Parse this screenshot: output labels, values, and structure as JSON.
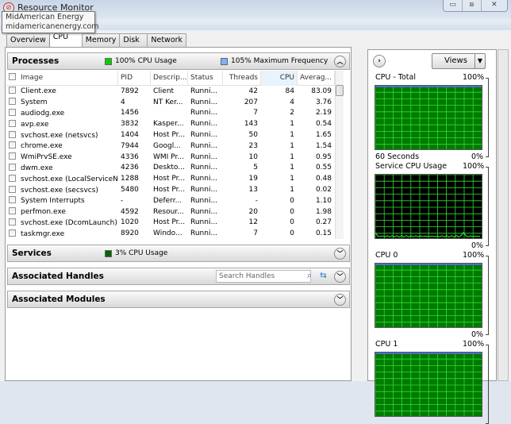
{
  "window": {
    "title": "Resource Monitor",
    "controls": [
      "▭",
      "⧈",
      "✕"
    ]
  },
  "tooltip": {
    "line1": "MidAmerican Energy",
    "line2": "midamericanenergy.com"
  },
  "tabs": [
    "Overview",
    "CPU",
    "Memory",
    "Disk",
    "Network"
  ],
  "active_tab": "CPU",
  "processes": {
    "title": "Processes",
    "cpu_usage": "100% CPU Usage",
    "cpu_usage_color": "#00d000",
    "max_freq": "105% Maximum Frequency",
    "max_freq_color": "#80b0ff",
    "columns": [
      "Image",
      "PID",
      "Descrip...",
      "Status",
      "Threads",
      "CPU",
      "Averag..."
    ],
    "rows": [
      [
        "Client.exe",
        "7892",
        "Client",
        "Runni...",
        "42",
        "84",
        "83.09"
      ],
      [
        "System",
        "4",
        "NT Ker...",
        "Runni...",
        "207",
        "4",
        "3.76"
      ],
      [
        "audiodg.exe",
        "1456",
        "",
        "Runni...",
        "7",
        "2",
        "2.19"
      ],
      [
        "avp.exe",
        "3832",
        "Kasper...",
        "Runni...",
        "143",
        "1",
        "0.54"
      ],
      [
        "svchost.exe (netsvcs)",
        "1404",
        "Host Pr...",
        "Runni...",
        "50",
        "1",
        "1.65"
      ],
      [
        "chrome.exe",
        "7944",
        "Googl...",
        "Runni...",
        "23",
        "1",
        "1.54"
      ],
      [
        "WmiPrvSE.exe",
        "4336",
        "WMI Pr...",
        "Runni...",
        "10",
        "1",
        "0.95"
      ],
      [
        "dwm.exe",
        "4236",
        "Deskto...",
        "Runni...",
        "5",
        "1",
        "0.55"
      ],
      [
        "svchost.exe (LocalServiceNet...",
        "1288",
        "Host Pr...",
        "Runni...",
        "19",
        "1",
        "0.48"
      ],
      [
        "svchost.exe (secsvcs)",
        "5480",
        "Host Pr...",
        "Runni...",
        "13",
        "1",
        "0.02"
      ],
      [
        "System Interrupts",
        "-",
        "Deferr...",
        "Runni...",
        "-",
        "0",
        "1.10"
      ],
      [
        "perfmon.exe",
        "4592",
        "Resour...",
        "Runni...",
        "20",
        "0",
        "1.98"
      ],
      [
        "svchost.exe (DcomLaunch)",
        "1020",
        "Host Pr...",
        "Runni...",
        "12",
        "0",
        "0.27"
      ],
      [
        "taskmgr.exe",
        "8920",
        "Windo...",
        "Runni...",
        "7",
        "0",
        "0.15"
      ]
    ]
  },
  "services": {
    "title": "Services",
    "cpu_usage": "3% CPU Usage",
    "color": "#006400"
  },
  "handles": {
    "title": "Associated Handles",
    "search_placeholder": "Search Handles"
  },
  "modules": {
    "title": "Associated Modules"
  },
  "right": {
    "views_label": "Views",
    "graphs": [
      {
        "title": "CPU - Total",
        "max": "100%",
        "min": "0%",
        "footer": "60 Seconds",
        "level_percent": 100,
        "bg": "#007a00"
      },
      {
        "title": "Service CPU Usage",
        "max": "100%",
        "min": "0%",
        "level_percent": 3,
        "bg": "#000000"
      },
      {
        "title": "CPU 0",
        "max": "100%",
        "min": "0%",
        "level_percent": 100,
        "bg": "#007a00"
      },
      {
        "title": "CPU 1",
        "max": "100%",
        "level_percent": 100,
        "bg": "#007a00"
      }
    ]
  }
}
